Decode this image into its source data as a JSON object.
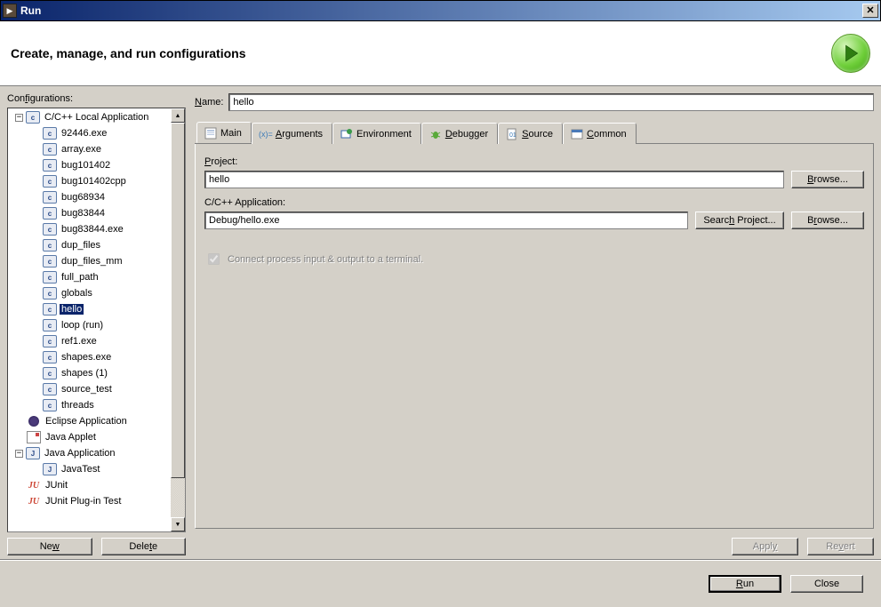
{
  "window": {
    "title": "Run"
  },
  "header": {
    "title": "Create, manage, and run configurations"
  },
  "left": {
    "label": "Configurations:",
    "new_btn": "New",
    "delete_btn": "Delete",
    "tree": [
      {
        "label": "C/C++ Local Application",
        "icon": "c",
        "depth": 1,
        "expanded": true,
        "hasExpander": true
      },
      {
        "label": "92446.exe",
        "icon": "c",
        "depth": 2
      },
      {
        "label": "array.exe",
        "icon": "c",
        "depth": 2
      },
      {
        "label": "bug101402",
        "icon": "c",
        "depth": 2
      },
      {
        "label": "bug101402cpp",
        "icon": "c",
        "depth": 2
      },
      {
        "label": "bug68934",
        "icon": "c",
        "depth": 2
      },
      {
        "label": "bug83844",
        "icon": "c",
        "depth": 2
      },
      {
        "label": "bug83844.exe",
        "icon": "c",
        "depth": 2
      },
      {
        "label": "dup_files",
        "icon": "c",
        "depth": 2
      },
      {
        "label": "dup_files_mm",
        "icon": "c",
        "depth": 2
      },
      {
        "label": "full_path",
        "icon": "c",
        "depth": 2
      },
      {
        "label": "globals",
        "icon": "c",
        "depth": 2
      },
      {
        "label": "hello",
        "icon": "c",
        "depth": 2,
        "selected": true
      },
      {
        "label": "loop (run)",
        "icon": "c",
        "depth": 2
      },
      {
        "label": "ref1.exe",
        "icon": "c",
        "depth": 2
      },
      {
        "label": "shapes.exe",
        "icon": "c",
        "depth": 2
      },
      {
        "label": "shapes (1)",
        "icon": "c",
        "depth": 2
      },
      {
        "label": "source_test",
        "icon": "c",
        "depth": 2
      },
      {
        "label": "threads",
        "icon": "c",
        "depth": 2
      },
      {
        "label": "Eclipse Application",
        "icon": "eclipse",
        "depth": 1
      },
      {
        "label": "Java Applet",
        "icon": "applet",
        "depth": 1
      },
      {
        "label": "Java Application",
        "icon": "j",
        "depth": 1,
        "expanded": true,
        "hasExpander": true
      },
      {
        "label": "JavaTest",
        "icon": "j",
        "depth": 2
      },
      {
        "label": "JUnit",
        "icon": "junit",
        "depth": 1
      },
      {
        "label": "JUnit Plug-in Test",
        "icon": "junit",
        "depth": 1
      }
    ]
  },
  "form": {
    "name_label": "Name:",
    "name_value": "hello",
    "tabs": [
      "Main",
      "Arguments",
      "Environment",
      "Debugger",
      "Source",
      "Common"
    ],
    "project_label": "Project:",
    "project_value": "hello",
    "app_label": "C/C++ Application:",
    "app_value": "Debug/hello.exe",
    "browse": "Browse...",
    "search_project": "Search Project...",
    "checkbox_label": "Connect process input & output to a terminal.",
    "apply": "Apply",
    "revert": "Revert"
  },
  "footer": {
    "run": "Run",
    "close": "Close"
  }
}
